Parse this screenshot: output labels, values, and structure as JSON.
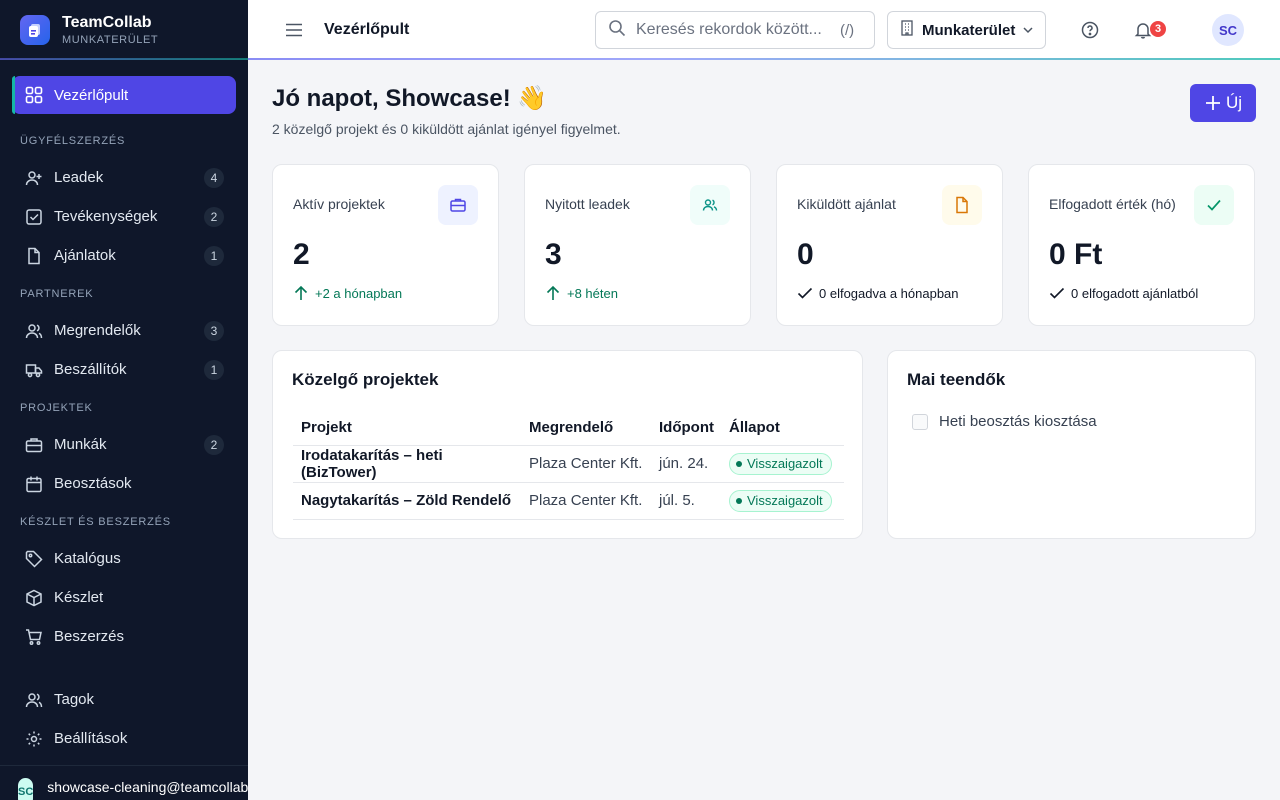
{
  "brand": {
    "name": "TeamCollab",
    "subtitle": "MUNKATERÜLET"
  },
  "sidebar": {
    "dashboard": {
      "label": "Vezérlőpult",
      "icon": "grid-icon"
    },
    "sections": [
      {
        "label": "ÜGYFÉLSZERZÉS",
        "items": [
          {
            "label": "Leadek",
            "count": "4",
            "icon": "user-plus-icon"
          },
          {
            "label": "Tevékenységek",
            "count": "2",
            "icon": "checkbox-icon"
          },
          {
            "label": "Ajánlatok",
            "count": "1",
            "icon": "document-icon"
          }
        ]
      },
      {
        "label": "PARTNEREK",
        "items": [
          {
            "label": "Megrendelők",
            "count": "3",
            "icon": "users-icon"
          },
          {
            "label": "Beszállítók",
            "count": "1",
            "icon": "truck-icon"
          }
        ]
      },
      {
        "label": "PROJEKTEK",
        "items": [
          {
            "label": "Munkák",
            "count": "2",
            "icon": "briefcase-icon"
          },
          {
            "label": "Beosztások",
            "count": "",
            "icon": "calendar-icon"
          }
        ]
      },
      {
        "label": "KÉSZLET ÉS BESZERZÉS",
        "items": [
          {
            "label": "Katalógus",
            "count": "",
            "icon": "tag-icon"
          },
          {
            "label": "Készlet",
            "count": "",
            "icon": "box-icon"
          },
          {
            "label": "Beszerzés",
            "count": "",
            "icon": "cart-icon"
          }
        ]
      }
    ],
    "bottom": [
      {
        "label": "Tagok",
        "icon": "users-icon"
      },
      {
        "label": "Beállítások",
        "icon": "gear-icon"
      }
    ],
    "user": {
      "initials": "SC",
      "email": "showcase-cleaning@teamcollab"
    }
  },
  "topbar": {
    "title": "Vezérlőpult",
    "search_placeholder": "Keresés rekordok között...",
    "search_hint": "(/)",
    "workspace": "Munkaterület",
    "notifications": "3",
    "avatar": "SC"
  },
  "main": {
    "greeting": "Jó napot, Showcase! 👋",
    "subtitle": "2 közelgő projekt és 0 kiküldött ajánlat igényel figyelmet.",
    "new_button": "Új",
    "stats": [
      {
        "label": "Aktív projektek",
        "value": "2",
        "foot": "+2 a hónapban",
        "icon": "briefcase-icon",
        "tone": "indigo",
        "trend": "up"
      },
      {
        "label": "Nyitott leadek",
        "value": "3",
        "foot": "+8 héten",
        "icon": "users-icon",
        "tone": "teal",
        "trend": "up"
      },
      {
        "label": "Kiküldött ajánlat",
        "value": "0",
        "foot": "0 elfogadva a hónapban",
        "icon": "document-icon",
        "tone": "amber",
        "trend": "check"
      },
      {
        "label": "Elfogadott érték (hó)",
        "value": "0 Ft",
        "foot": "0 elfogadott ajánlatból",
        "icon": "check-icon",
        "tone": "green",
        "trend": "check"
      }
    ],
    "projects": {
      "title": "Közelgő projektek",
      "columns": [
        "Projekt",
        "Megrendelő",
        "Időpont",
        "Állapot"
      ],
      "rows": [
        {
          "project": "Irodatakarítás – heti (BizTower)",
          "client": "Plaza Center Kft.",
          "date": "jún. 24.",
          "status": "Visszaigazolt"
        },
        {
          "project": "Nagytakarítás – Zöld Rendelő",
          "client": "Plaza Center Kft.",
          "date": "júl. 5.",
          "status": "Visszaigazolt"
        }
      ]
    },
    "todos": {
      "title": "Mai teendők",
      "items": [
        {
          "label": "Heti beosztás kiosztása",
          "done": false
        }
      ]
    }
  },
  "colors": {
    "accent": "#4f46e5",
    "sidebar": "#0f172a",
    "success": "#047857",
    "badge": "#ef4444"
  }
}
